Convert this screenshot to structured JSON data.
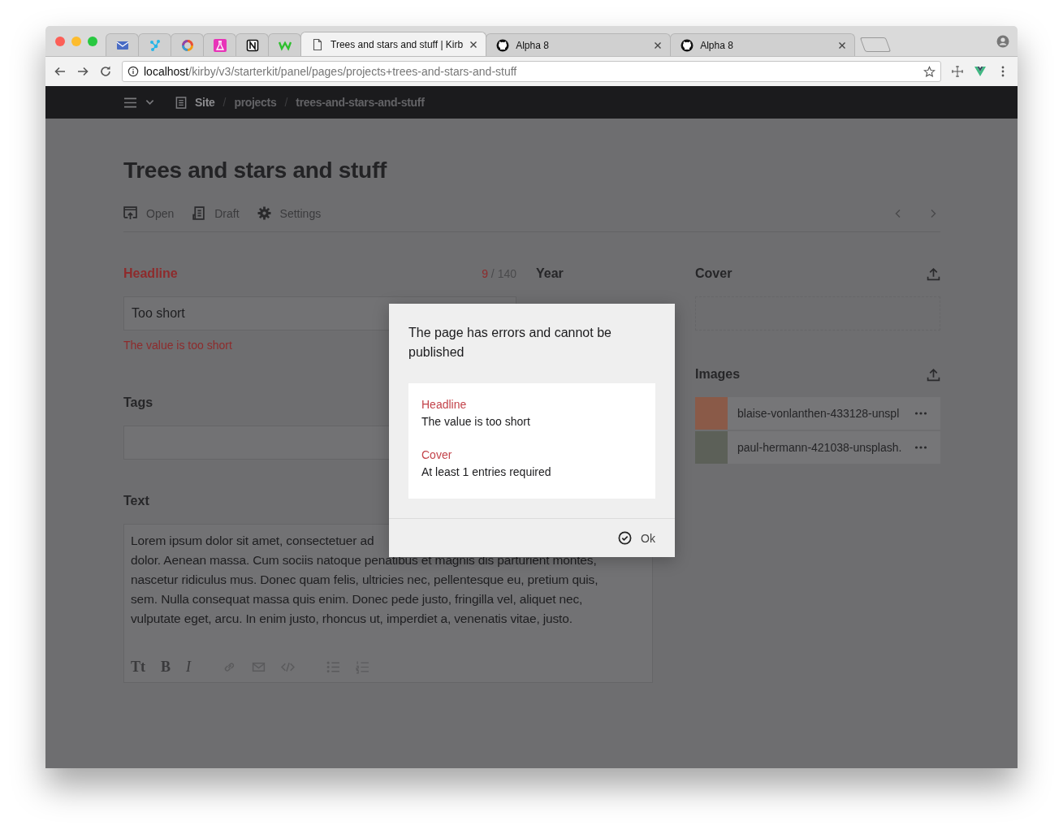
{
  "browser": {
    "tabs": [
      {
        "kind": "mail",
        "selected": false
      },
      {
        "kind": "network",
        "selected": false
      },
      {
        "kind": "ring",
        "selected": false
      },
      {
        "kind": "flask",
        "selected": false
      },
      {
        "kind": "square",
        "selected": false
      },
      {
        "kind": "wave",
        "selected": false
      },
      {
        "kind": "page",
        "label": "Trees and stars and stuff | Kirb",
        "selected": true
      },
      {
        "kind": "github",
        "label": "Alpha 8",
        "selected": false
      },
      {
        "kind": "github",
        "label": "Alpha 8",
        "selected": false
      }
    ],
    "url_host": "localhost",
    "url_path": "/kirby/v3/starterkit/panel/pages/projects+trees-and-stars-and-stuff"
  },
  "nav": {
    "breadcrumbs": [
      "Site",
      "projects",
      "trees-and-stars-and-stuff"
    ],
    "separator": "/"
  },
  "page": {
    "title": "Trees and stars and stuff",
    "actions": [
      {
        "kind": "open",
        "label": "Open"
      },
      {
        "kind": "draft",
        "label": "Draft"
      },
      {
        "kind": "settings",
        "label": "Settings"
      }
    ]
  },
  "fields": {
    "headline": {
      "label": "Headline",
      "invalid": true,
      "count": "9",
      "limit": "/ 140",
      "value": "Too short",
      "error": "The value is too short"
    },
    "year": {
      "label": "Year"
    },
    "tags": {
      "label": "Tags"
    },
    "text": {
      "label": "Text",
      "lines": [
        "Lorem ipsum dolor sit amet, consectetuer ad",
        "dolor. Aenean massa. Cum sociis natoque penatibus et magnis dis parturient montes,",
        "nascetur ridiculus mus. Donec quam felis, ultricies nec, pellentesque eu, pretium quis,",
        "sem. Nulla consequat massa quis enim. Donec pede justo, fringilla vel, aliquet nec,",
        "vulputate eget, arcu. In enim justo, rhoncus ut, imperdiet a, venenatis vitae, justo."
      ],
      "toolbar": [
        {
          "kind": "glyph",
          "label": "Tt"
        },
        {
          "kind": "glyph",
          "label": "B"
        },
        {
          "kind": "glyph",
          "label": "I"
        },
        {
          "kind": "link"
        },
        {
          "kind": "email"
        },
        {
          "kind": "code"
        },
        {
          "kind": "bullets"
        },
        {
          "kind": "numbers"
        }
      ]
    },
    "cover": {
      "label": "Cover"
    },
    "images": {
      "label": "Images",
      "files": [
        {
          "name": "blaise-vonlanthen-433128-unspl",
          "color": "#8a5a48"
        },
        {
          "name": "paul-hermann-421038-unsplash.",
          "color": "#5c6058"
        }
      ]
    }
  },
  "dialog": {
    "message": "The page has errors and cannot be published",
    "errors": [
      {
        "field": "Headline",
        "message": "The value is too short"
      },
      {
        "field": "Cover",
        "message": "At least 1 entries required"
      }
    ],
    "button": "Ok"
  }
}
